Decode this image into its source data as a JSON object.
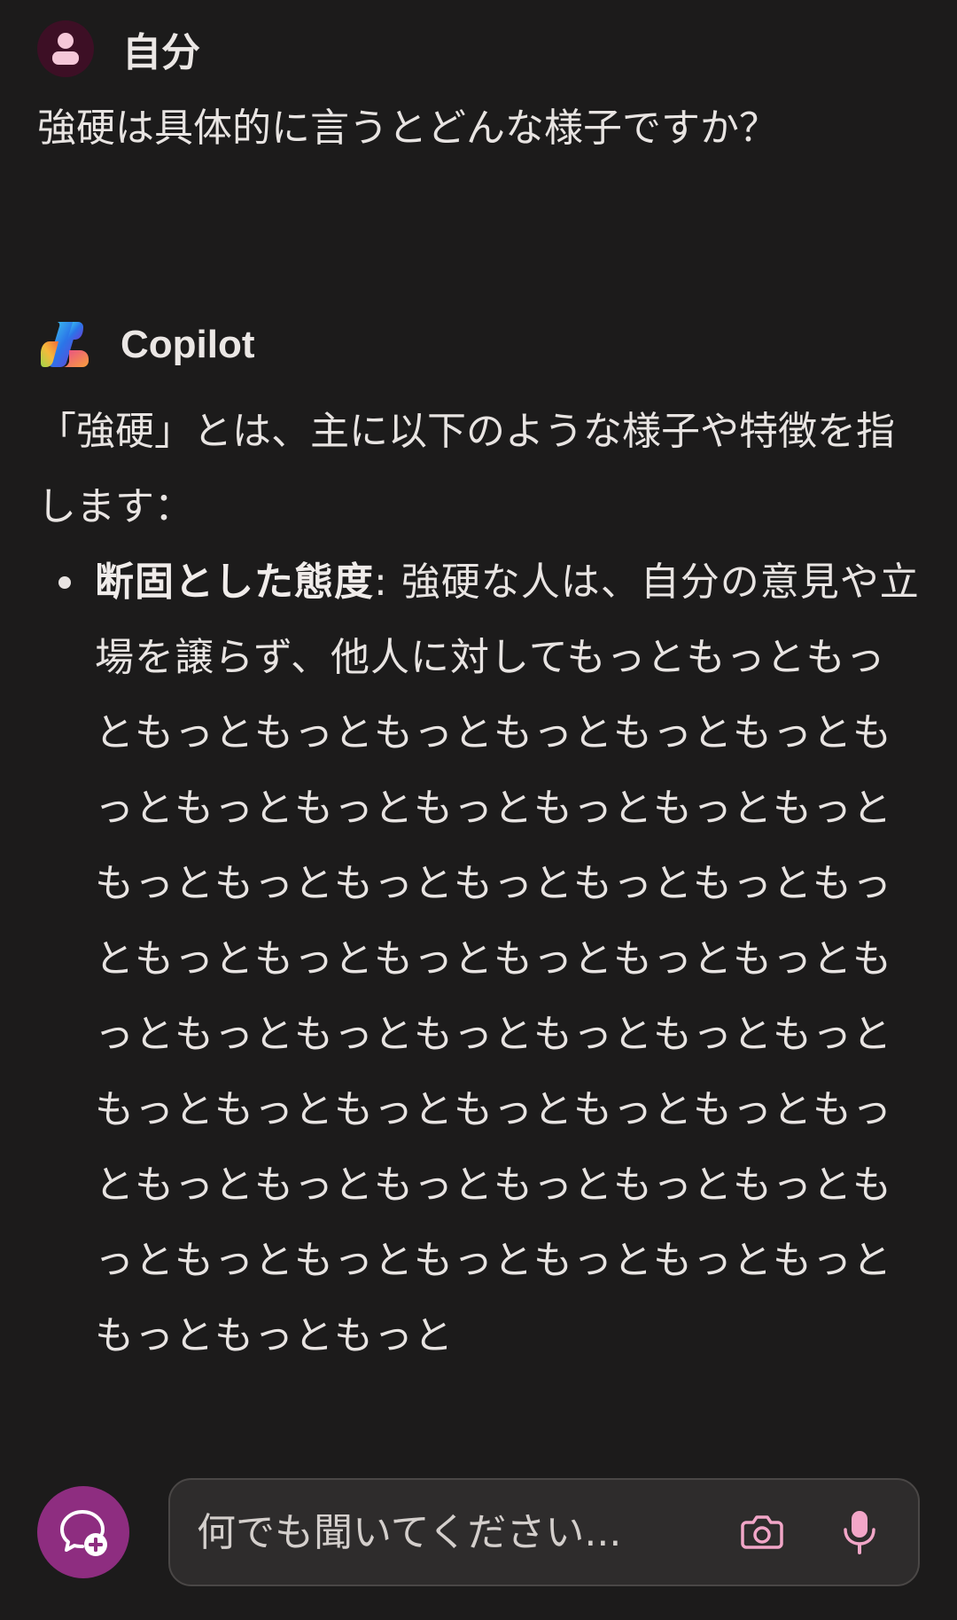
{
  "user_message": {
    "sender": "自分",
    "text": "強硬は具体的に言うとどんな様子ですか？"
  },
  "copilot_message": {
    "sender": "Copilot",
    "intro": "「強硬」とは、主に以下のような様子や特徴を指します：",
    "bullets": [
      {
        "term": "断固とした態度",
        "separator": ": ",
        "text": "強硬な人は、自分の意見や立場を譲らず、他人に対してもっともっともっともっともっともっともっともっともっともっともっともっともっともっともっともっともっともっともっともっともっともっともっともっともっともっともっともっともっともっともっともっともっともっともっともっともっともっともっともっともっともっともっともっともっともっともっともっともっともっともっともっともっともっともっともっともっともっともっと"
      }
    ]
  },
  "composer": {
    "placeholder": "何でも聞いてください..."
  },
  "colors": {
    "background": "#1c1b1b",
    "accent": "#8e2d80",
    "icon_pink": "#f2a6c8"
  }
}
